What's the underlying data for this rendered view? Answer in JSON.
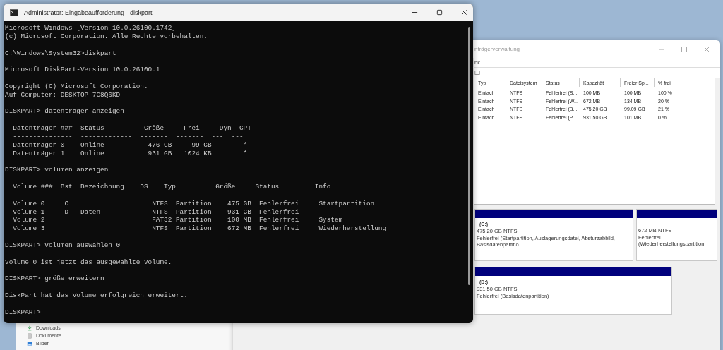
{
  "explorer_window": {
    "sidebar_items": [
      {
        "kind": "download",
        "label": "Downloads"
      },
      {
        "kind": "document",
        "label": "Dokumente"
      },
      {
        "kind": "picture",
        "label": "Bilder"
      }
    ]
  },
  "disk_management_window": {
    "title": "nträgerverwaltung",
    "menu": [
      "nk"
    ],
    "table": {
      "columns": [
        "Typ",
        "Dateisystem",
        "Status",
        "Kapazität",
        "Freier Sp...",
        "% frei"
      ],
      "rows": [
        [
          "Einfach",
          "NTFS",
          "Fehlerfrei (S...",
          "100 MB",
          "100 MB",
          "100 %"
        ],
        [
          "Einfach",
          "NTFS",
          "Fehlerfrei (W...",
          "672 MB",
          "134 MB",
          "20 %"
        ],
        [
          "Einfach",
          "NTFS",
          "Fehlerfrei (B...",
          "475,20 GB",
          "99,09 GB",
          "21 %"
        ],
        [
          "Einfach",
          "NTFS",
          "Fehlerfrei (P...",
          "931,50 GB",
          "101 MB",
          "0 %"
        ]
      ]
    },
    "disk_map": [
      {
        "partitions": [
          {
            "label": "(C:)",
            "size": "475,20 GB NTFS",
            "status": "Fehlerfrei (Startpartition, Auslagerungsdatei, Absturzabbild, Basisdatenpartitio"
          },
          {
            "size": "672 MB NTFS",
            "status": "Fehlerfrei (Wiederherstellungspartition,"
          }
        ]
      },
      {
        "partitions": [
          {
            "label": "(D:)",
            "size": "931,50 GB NTFS",
            "status": "Fehlerfrei (Basisdatenpartition)"
          }
        ]
      }
    ]
  },
  "cmd_window": {
    "title": "Administrator: Eingabeaufforderung - diskpart",
    "console_blocks": [
      [
        "Microsoft Windows [Version 10.0.26100.1742]",
        "(c) Microsoft Corporation. Alle Rechte vorbehalten."
      ],
      [
        "C:\\Windows\\System32>diskpart"
      ],
      [
        "Microsoft DiskPart-Version 10.0.26100.1"
      ],
      [
        "Copyright (C) Microsoft Corporation.",
        "Auf Computer: DESKTOP-7G8Q6KD"
      ],
      [
        "DISKPART> datenträger anzeigen"
      ],
      [
        "  Datenträger ###  Status          Größe     Frei     Dyn  GPT",
        "  ---------------  -------------  -------  -------  ---  ---",
        "  Datenträger 0    Online           476 GB     99 GB        *",
        "  Datenträger 1    Online           931 GB   1024 KB        *"
      ],
      [
        "DISKPART> volumen anzeigen"
      ],
      [
        "  Volume ###  Bst  Bezeichnung    DS    Typ          Größe     Status         Info",
        "  ----------  ---  -----------  -----  ----------  -------  ----------  ---------------",
        "  Volume 0     C                     NTFS  Partition    475 GB  Fehlerfrei     Startpartition",
        "  Volume 1     D   Daten             NTFS  Partition    931 GB  Fehlerfrei",
        "  Volume 2                           FAT32 Partition    100 MB  Fehlerfrei     System",
        "  Volume 3                           NTFS  Partition    672 MB  Fehlerfrei     Wiederherstellung"
      ],
      [
        "DISKPART> volumen auswählen 0"
      ],
      [
        "Volume 0 ist jetzt das ausgewählte Volume."
      ],
      [
        "DISKPART> größe erweitern"
      ],
      [
        "DiskPart hat das Volume erfolgreich erweitert."
      ],
      [
        "DISKPART>"
      ]
    ]
  }
}
